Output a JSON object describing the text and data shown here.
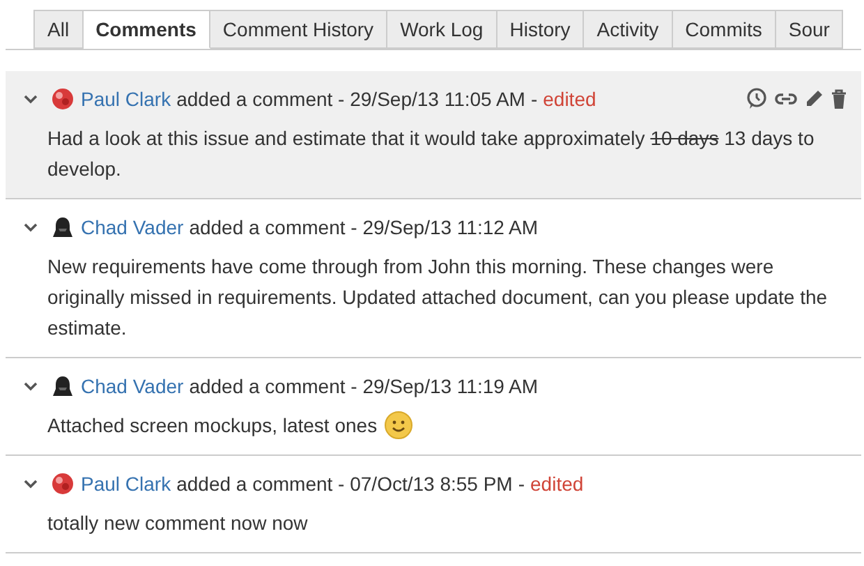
{
  "tabs": [
    {
      "label": "All",
      "selected": false
    },
    {
      "label": "Comments",
      "selected": true
    },
    {
      "label": "Comment History",
      "selected": false
    },
    {
      "label": "Work Log",
      "selected": false
    },
    {
      "label": "History",
      "selected": false
    },
    {
      "label": "Activity",
      "selected": false
    },
    {
      "label": "Commits",
      "selected": false
    },
    {
      "label": "Sour",
      "selected": false
    }
  ],
  "comments": [
    {
      "highlighted": true,
      "kind": "ball",
      "author": "Paul Clark",
      "action": "added a comment -",
      "date": "29/Sep/13 11:05 AM",
      "separator": "-",
      "edited": "edited",
      "smiley": false,
      "body": [
        {
          "kind": "text",
          "text": "Had a look at this issue and estimate that it would take approximately "
        },
        {
          "kind": "struck",
          "text": "10 days"
        },
        {
          "kind": "text",
          "text": " 13 days to develop."
        }
      ]
    },
    {
      "highlighted": false,
      "kind": "helmet",
      "author": "Chad Vader",
      "action": "added a comment -",
      "date": "29/Sep/13 11:12 AM",
      "smiley": false,
      "body": [
        {
          "kind": "text",
          "text": "New requirements have come through from John this morning. These changes were originally missed in requirements. Updated attached document, can you please update the estimate."
        }
      ]
    },
    {
      "highlighted": false,
      "kind": "helmet",
      "author": "Chad Vader",
      "action": "added a comment -",
      "date": "29/Sep/13 11:19 AM",
      "smiley": true,
      "body": [
        {
          "kind": "text",
          "text": "Attached screen mockups, latest ones"
        }
      ]
    },
    {
      "highlighted": false,
      "kind": "ball",
      "author": "Paul Clark",
      "action": "added a comment -",
      "date": "07/Oct/13 8:55 PM",
      "separator": "-",
      "edited": "edited",
      "smiley": false,
      "body": [
        {
          "kind": "text",
          "text": "totally new comment now now"
        }
      ]
    }
  ]
}
